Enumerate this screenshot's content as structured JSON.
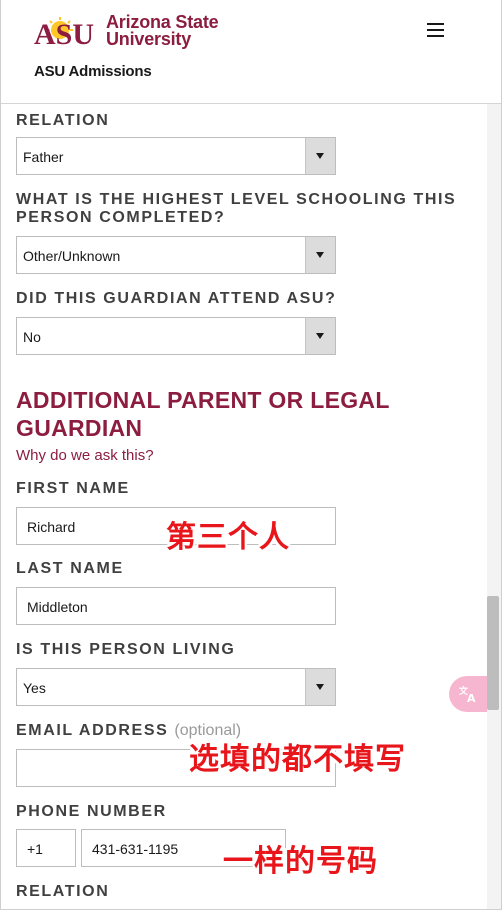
{
  "brand": {
    "logo_mark": "ASU",
    "logo_line1": "Arizona State",
    "logo_line2": "University",
    "site_title": "ASU Admissions",
    "primary_color": "#8c1d40",
    "gold_color": "#ffc627"
  },
  "menu": {
    "icon": "hamburger-menu-icon"
  },
  "guardian1": {
    "relation_label": "RELATION",
    "relation_value": "Father",
    "schooling_label_line1": "WHAT IS THE HIGHEST LEVEL SCHOOLING THIS",
    "schooling_label_line2": "PERSON COMPLETED?",
    "schooling_value": "Other/Unknown",
    "attend_label": "DID THIS GUARDIAN ATTEND ASU?",
    "attend_value": "No"
  },
  "section": {
    "title_line1": "ADDITIONAL PARENT OR LEGAL",
    "title_line2": "GUARDIAN",
    "why_link": "Why do we ask this?"
  },
  "guardian2": {
    "first_name_label": "FIRST NAME",
    "first_name_value": "Richard",
    "last_name_label": "LAST NAME",
    "last_name_value": "Middleton",
    "living_label": "IS THIS PERSON LIVING",
    "living_value": "Yes",
    "email_label": "EMAIL ADDRESS",
    "email_optional": "(optional)",
    "email_value": "",
    "phone_label": "PHONE NUMBER",
    "phone_code": "+1",
    "phone_value": "431-631-1195",
    "relation_label": "RELATION"
  },
  "annotations": {
    "third_person": "第三个人",
    "optional_note": "选填的都不填写",
    "same_number": "一样的号码"
  },
  "translate": {
    "icon": "translate-icon"
  }
}
